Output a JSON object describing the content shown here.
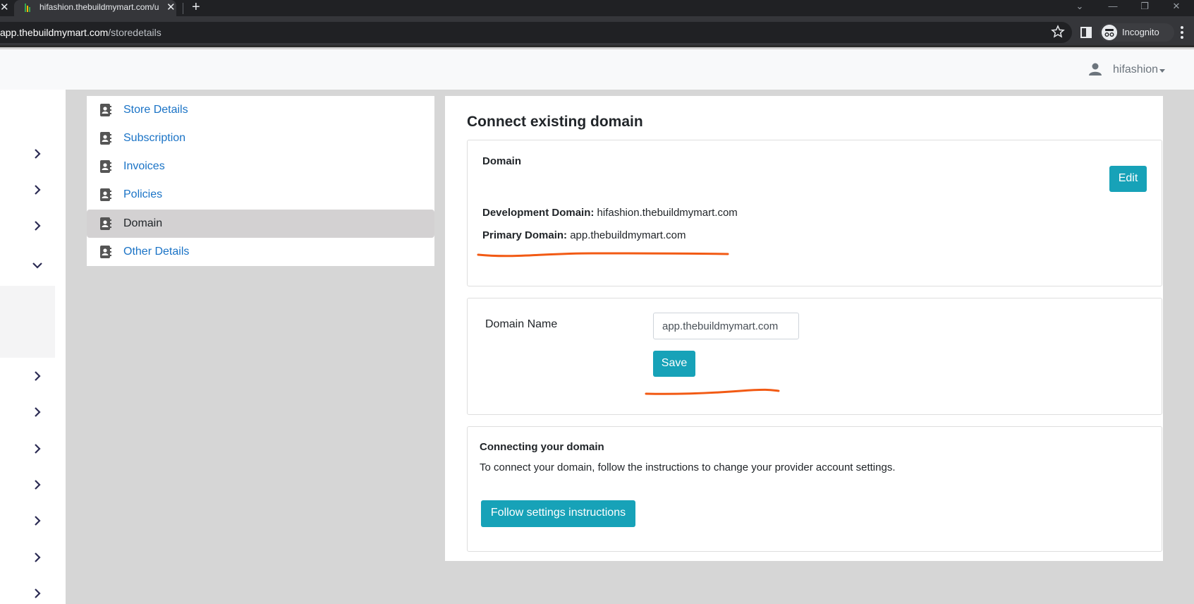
{
  "browser": {
    "tab_title": "hifashion.thebuildmymart.com/u",
    "url_host": "app.thebuildmymart.com",
    "url_path": "/storedetails",
    "profile_label": "Incognito"
  },
  "header": {
    "user_name": "hifashion"
  },
  "settings_menu": {
    "items": [
      {
        "label": "Store Details"
      },
      {
        "label": "Subscription"
      },
      {
        "label": "Invoices"
      },
      {
        "label": "Policies"
      },
      {
        "label": "Domain"
      },
      {
        "label": "Other Details"
      }
    ],
    "active_item": "Domain"
  },
  "main": {
    "title": "Connect existing domain",
    "domain_card": {
      "heading": "Domain",
      "edit_label": "Edit",
      "development_domain_label": "Development Domain:",
      "development_domain_value": "hifashion.thebuildmymart.com",
      "primary_domain_label": "Primary Domain:",
      "primary_domain_value": "app.thebuildmymart.com"
    },
    "domain_form": {
      "field_label": "Domain Name",
      "field_value": "app.thebuildmymart.com",
      "save_label": "Save"
    },
    "connect_card": {
      "heading": "Connecting your domain",
      "description": "To connect your domain, follow the instructions to change your provider account settings.",
      "button_label": "Follow settings instructions"
    }
  },
  "colors": {
    "accent": "#17a2b8",
    "link": "#1a73c6",
    "annotation": "#f25a14"
  }
}
